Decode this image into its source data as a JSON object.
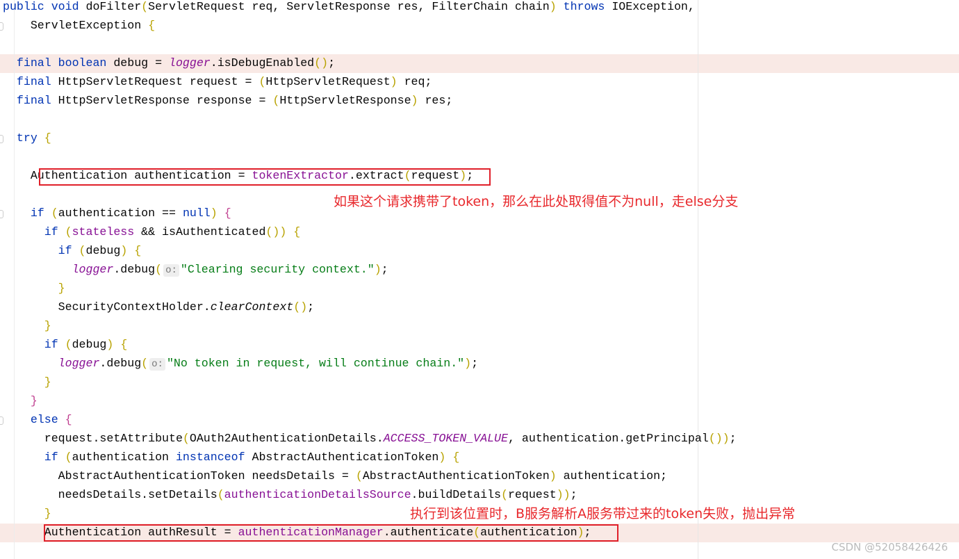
{
  "code_lines": [
    [
      [
        "public void ",
        "kw"
      ],
      [
        "doFilter",
        ""
      ],
      [
        "(",
        "par"
      ],
      [
        "ServletRequest req, ServletResponse res, FilterChain chain",
        ""
      ],
      [
        ")",
        "par"
      ],
      [
        " throws ",
        "kw"
      ],
      [
        "IOException,",
        ""
      ]
    ],
    [
      [
        "    ServletException ",
        ""
      ],
      [
        "{",
        "par"
      ]
    ],
    [],
    [
      [
        "  ",
        ""
      ],
      [
        "final boolean ",
        "kw"
      ],
      [
        "debug = ",
        ""
      ],
      [
        "logger",
        "ifld"
      ],
      [
        ".isDebugEnabled",
        ""
      ],
      [
        "()",
        "par"
      ],
      [
        ";",
        ""
      ]
    ],
    [
      [
        "  ",
        ""
      ],
      [
        "final ",
        "kw"
      ],
      [
        "HttpServletRequest request = ",
        ""
      ],
      [
        "(",
        "par"
      ],
      [
        "HttpServletRequest",
        ""
      ],
      [
        ")",
        "par"
      ],
      [
        " req;",
        ""
      ]
    ],
    [
      [
        "  ",
        ""
      ],
      [
        "final ",
        "kw"
      ],
      [
        "HttpServletResponse response = ",
        ""
      ],
      [
        "(",
        "par"
      ],
      [
        "HttpServletResponse",
        ""
      ],
      [
        ")",
        "par"
      ],
      [
        " res;",
        ""
      ]
    ],
    [],
    [
      [
        "  ",
        ""
      ],
      [
        "try ",
        "kw"
      ],
      [
        "{",
        "par"
      ]
    ],
    [],
    [
      [
        "    Authentication authentication = ",
        ""
      ],
      [
        "tokenExtractor",
        "fld"
      ],
      [
        ".extract",
        ""
      ],
      [
        "(",
        "par"
      ],
      [
        "request",
        ""
      ],
      [
        ")",
        "par"
      ],
      [
        ";",
        ""
      ]
    ],
    [],
    [
      [
        "    ",
        ""
      ],
      [
        "if ",
        "kw"
      ],
      [
        "(",
        "par"
      ],
      [
        "authentication == ",
        ""
      ],
      [
        "null",
        "kw"
      ],
      [
        ") ",
        "par"
      ],
      [
        "{",
        "br"
      ]
    ],
    [
      [
        "      ",
        ""
      ],
      [
        "if ",
        "kw"
      ],
      [
        "(",
        "par"
      ],
      [
        "stateless",
        "fld"
      ],
      [
        " && isAuthenticated",
        ""
      ],
      [
        "()",
        "par"
      ],
      [
        ") ",
        "par"
      ],
      [
        "{",
        "par"
      ]
    ],
    [
      [
        "        ",
        ""
      ],
      [
        "if ",
        "kw"
      ],
      [
        "(",
        "par"
      ],
      [
        "debug",
        ""
      ],
      [
        ") ",
        "par"
      ],
      [
        "{",
        "par"
      ]
    ],
    [
      [
        "          ",
        ""
      ],
      [
        "logger",
        "ifld"
      ],
      [
        ".debug",
        ""
      ],
      [
        "(",
        "par"
      ],
      [
        "HINT",
        ""
      ],
      [
        "\"Clearing security context.\"",
        "str"
      ],
      [
        ")",
        "par"
      ],
      [
        ";",
        ""
      ]
    ],
    [
      [
        "        ",
        ""
      ],
      [
        "}",
        "par"
      ]
    ],
    [
      [
        "        SecurityContextHolder.",
        ""
      ],
      [
        "clearContext",
        "it"
      ],
      [
        "()",
        "par"
      ],
      [
        ";",
        ""
      ]
    ],
    [
      [
        "      ",
        ""
      ],
      [
        "}",
        "par"
      ]
    ],
    [
      [
        "      ",
        ""
      ],
      [
        "if ",
        "kw"
      ],
      [
        "(",
        "par"
      ],
      [
        "debug",
        ""
      ],
      [
        ") ",
        "par"
      ],
      [
        "{",
        "par"
      ]
    ],
    [
      [
        "        ",
        ""
      ],
      [
        "logger",
        "ifld"
      ],
      [
        ".debug",
        ""
      ],
      [
        "(",
        "par"
      ],
      [
        "HINT",
        ""
      ],
      [
        "\"No token in request, will continue chain.\"",
        "str"
      ],
      [
        ")",
        "par"
      ],
      [
        ";",
        ""
      ]
    ],
    [
      [
        "      ",
        ""
      ],
      [
        "}",
        "par"
      ]
    ],
    [
      [
        "    ",
        ""
      ],
      [
        "}",
        "br"
      ]
    ],
    [
      [
        "    ",
        ""
      ],
      [
        "else ",
        "kw"
      ],
      [
        "{",
        "br"
      ]
    ],
    [
      [
        "      request.setAttribute",
        ""
      ],
      [
        "(",
        "par"
      ],
      [
        "OAuth2AuthenticationDetails.",
        ""
      ],
      [
        "ACCESS_TOKEN_VALUE",
        "ifld"
      ],
      [
        ", authentication.getPrincipal",
        ""
      ],
      [
        "()",
        "par"
      ],
      [
        ")",
        "par"
      ],
      [
        ";",
        ""
      ]
    ],
    [
      [
        "      ",
        ""
      ],
      [
        "if ",
        "kw"
      ],
      [
        "(",
        "par"
      ],
      [
        "authentication ",
        ""
      ],
      [
        "instanceof ",
        "kw"
      ],
      [
        "AbstractAuthenticationToken",
        ""
      ],
      [
        ") ",
        "par"
      ],
      [
        "{",
        "par"
      ]
    ],
    [
      [
        "        AbstractAuthenticationToken needsDetails = ",
        ""
      ],
      [
        "(",
        "par"
      ],
      [
        "AbstractAuthenticationToken",
        ""
      ],
      [
        ")",
        "par"
      ],
      [
        " authentication;",
        ""
      ]
    ],
    [
      [
        "        needsDetails.setDetails",
        ""
      ],
      [
        "(",
        "par"
      ],
      [
        "authenticationDetailsSource",
        "fld"
      ],
      [
        ".buildDetails",
        ""
      ],
      [
        "(",
        "par"
      ],
      [
        "request",
        ""
      ],
      [
        ")",
        "par"
      ],
      [
        ")",
        "par"
      ],
      [
        ";",
        ""
      ]
    ],
    [
      [
        "      ",
        ""
      ],
      [
        "}",
        "par"
      ]
    ],
    [
      [
        "      Authentication authResult = ",
        ""
      ],
      [
        "authenticationManager",
        "fld"
      ],
      [
        ".authenticate",
        ""
      ],
      [
        "(",
        "par"
      ],
      [
        "authentication",
        ""
      ],
      [
        ")",
        "par"
      ],
      [
        ";",
        ""
      ]
    ]
  ],
  "param_hint": "o:",
  "annotations": {
    "note1": "如果这个请求携带了token，那么在此处取得值不为null，走else分支",
    "note2": "执行到该位置时，B服务解析A服务带过来的token失败，抛出异常"
  },
  "watermark": "CSDN @52058426426",
  "colors": {
    "keyword": "#0033b3",
    "field": "#871094",
    "string": "#067d17",
    "annotation": "#e8282c",
    "highlight": "#f9e9e5"
  }
}
